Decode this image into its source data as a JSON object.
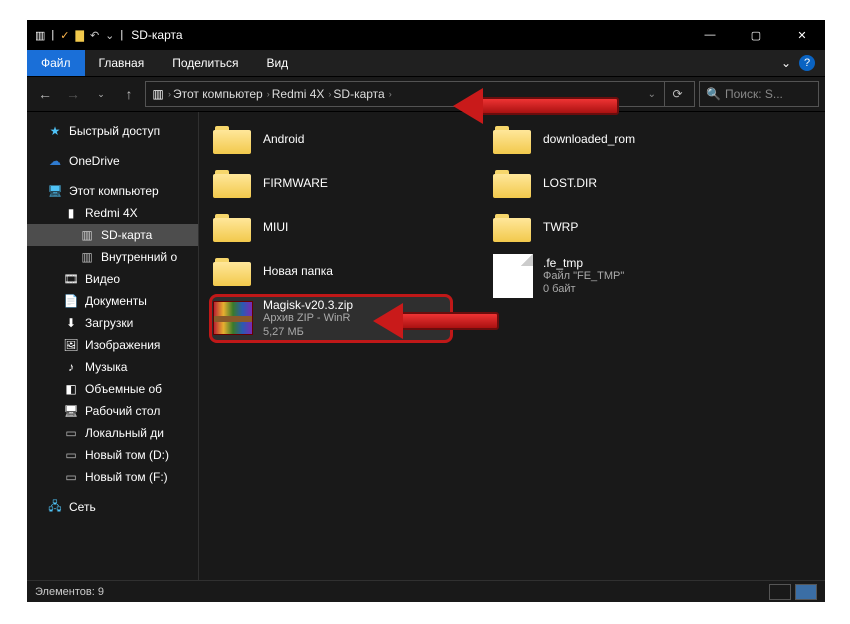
{
  "window": {
    "title": "SD-карта",
    "controls": {
      "min": "—",
      "max": "▢",
      "close": "✕"
    }
  },
  "ribbon": {
    "file": "Файл",
    "tabs": [
      "Главная",
      "Поделиться",
      "Вид"
    ],
    "expand": "⌄",
    "help": "?"
  },
  "nav": {
    "back": "←",
    "fwd": "→",
    "dropdown": "⌄",
    "up": "↑"
  },
  "breadcrumbs": [
    "Этот компьютер",
    "Redmi 4X",
    "SD-карта"
  ],
  "addr": {
    "dropdown": "⌄",
    "refresh": "⟳"
  },
  "search": {
    "icon": "🔍",
    "placeholder": "Поиск: S..."
  },
  "sidebar": {
    "quick": "Быстрый доступ",
    "onedrive": "OneDrive",
    "pc": "Этот компьютер",
    "redmi": "Redmi 4X",
    "sd": "SD-карта",
    "internal": "Внутренний о",
    "video": "Видео",
    "docs": "Документы",
    "downloads": "Загрузки",
    "pictures": "Изображения",
    "music": "Музыка",
    "objects": "Объемные об",
    "desktop": "Рабочий стол",
    "local_d": "Локальный ди",
    "vol_d": "Новый том (D:)",
    "vol_f": "Новый том (F:)",
    "network": "Сеть"
  },
  "items_left": [
    {
      "name": "Android",
      "type": "folder"
    },
    {
      "name": "FIRMWARE",
      "type": "folder"
    },
    {
      "name": "MIUI",
      "type": "folder"
    },
    {
      "name": "Новая папка",
      "type": "folder"
    },
    {
      "name": "Magisk-v20.3.zip",
      "type": "zip",
      "sub1": "Архив ZIP - WinR",
      "sub2": "5,27 МБ"
    }
  ],
  "items_right": [
    {
      "name": "downloaded_rom",
      "type": "folder"
    },
    {
      "name": "LOST.DIR",
      "type": "folder"
    },
    {
      "name": "TWRP",
      "type": "folder"
    },
    {
      "name": ".fe_tmp",
      "type": "file",
      "sub1": "Файл \"FE_TMP\"",
      "sub2": "0 байт"
    }
  ],
  "status": {
    "count_label": "Элементов: 9"
  }
}
